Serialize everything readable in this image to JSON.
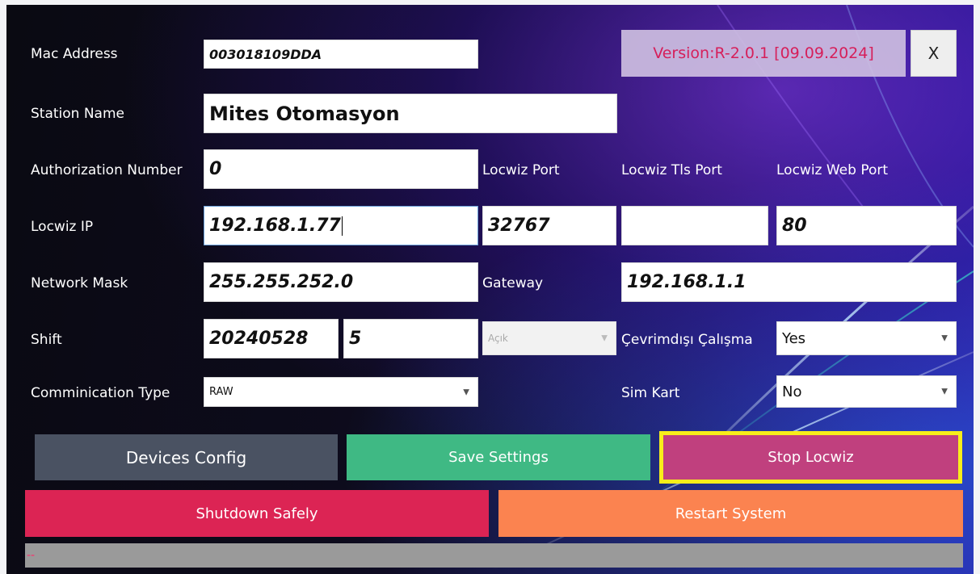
{
  "fields": {
    "mac_label": "Mac Address",
    "mac_value": "003018109DDA",
    "station_label": "Station Name",
    "station_value": "Mites Otomasyon",
    "auth_label": "Authorization Number",
    "auth_value": "0",
    "locwiz_port_label": "Locwiz Port",
    "locwiz_tls_port_label": "Locwiz Tls Port",
    "locwiz_web_port_label": "Locwiz Web Port",
    "locwiz_ip_label": "Locwiz IP",
    "locwiz_ip_value": "192.168.1.77",
    "locwiz_port_value": "32767",
    "locwiz_tls_port_value": "",
    "locwiz_web_port_value": "80",
    "mask_label": "Network Mask",
    "mask_value": "255.255.252.0",
    "gateway_label": "Gateway",
    "gateway_value": "192.168.1.1",
    "shift_label": "Shift",
    "shift_value": "20240528",
    "shift_no_value": "5",
    "shift_state_value": "Açık",
    "offline_label": "Çevrimdışı Çalışma",
    "offline_value": "Yes",
    "comm_label": "Comminication Type",
    "comm_value": "RAW",
    "sim_label": "Sim Kart",
    "sim_value": "No"
  },
  "header": {
    "version": "Version:R-2.0.1 [09.09.2024]",
    "close_label": "X"
  },
  "buttons": {
    "devices_config": "Devices Config",
    "save_settings": "Save Settings",
    "stop_locwiz": "Stop Locwiz",
    "shutdown": "Shutdown Safely",
    "restart": "Restart System"
  },
  "status": {
    "text": "--"
  },
  "colors": {
    "devices_config": "#4a5262",
    "save_settings": "#3fb984",
    "stop_locwiz": "#c0407e",
    "stop_highlight": "#f7ee1a",
    "shutdown": "#dc2454",
    "restart": "#fb8350",
    "version_text": "#d61f5a"
  },
  "icons": {
    "dropdown": "chevron-down-icon"
  }
}
